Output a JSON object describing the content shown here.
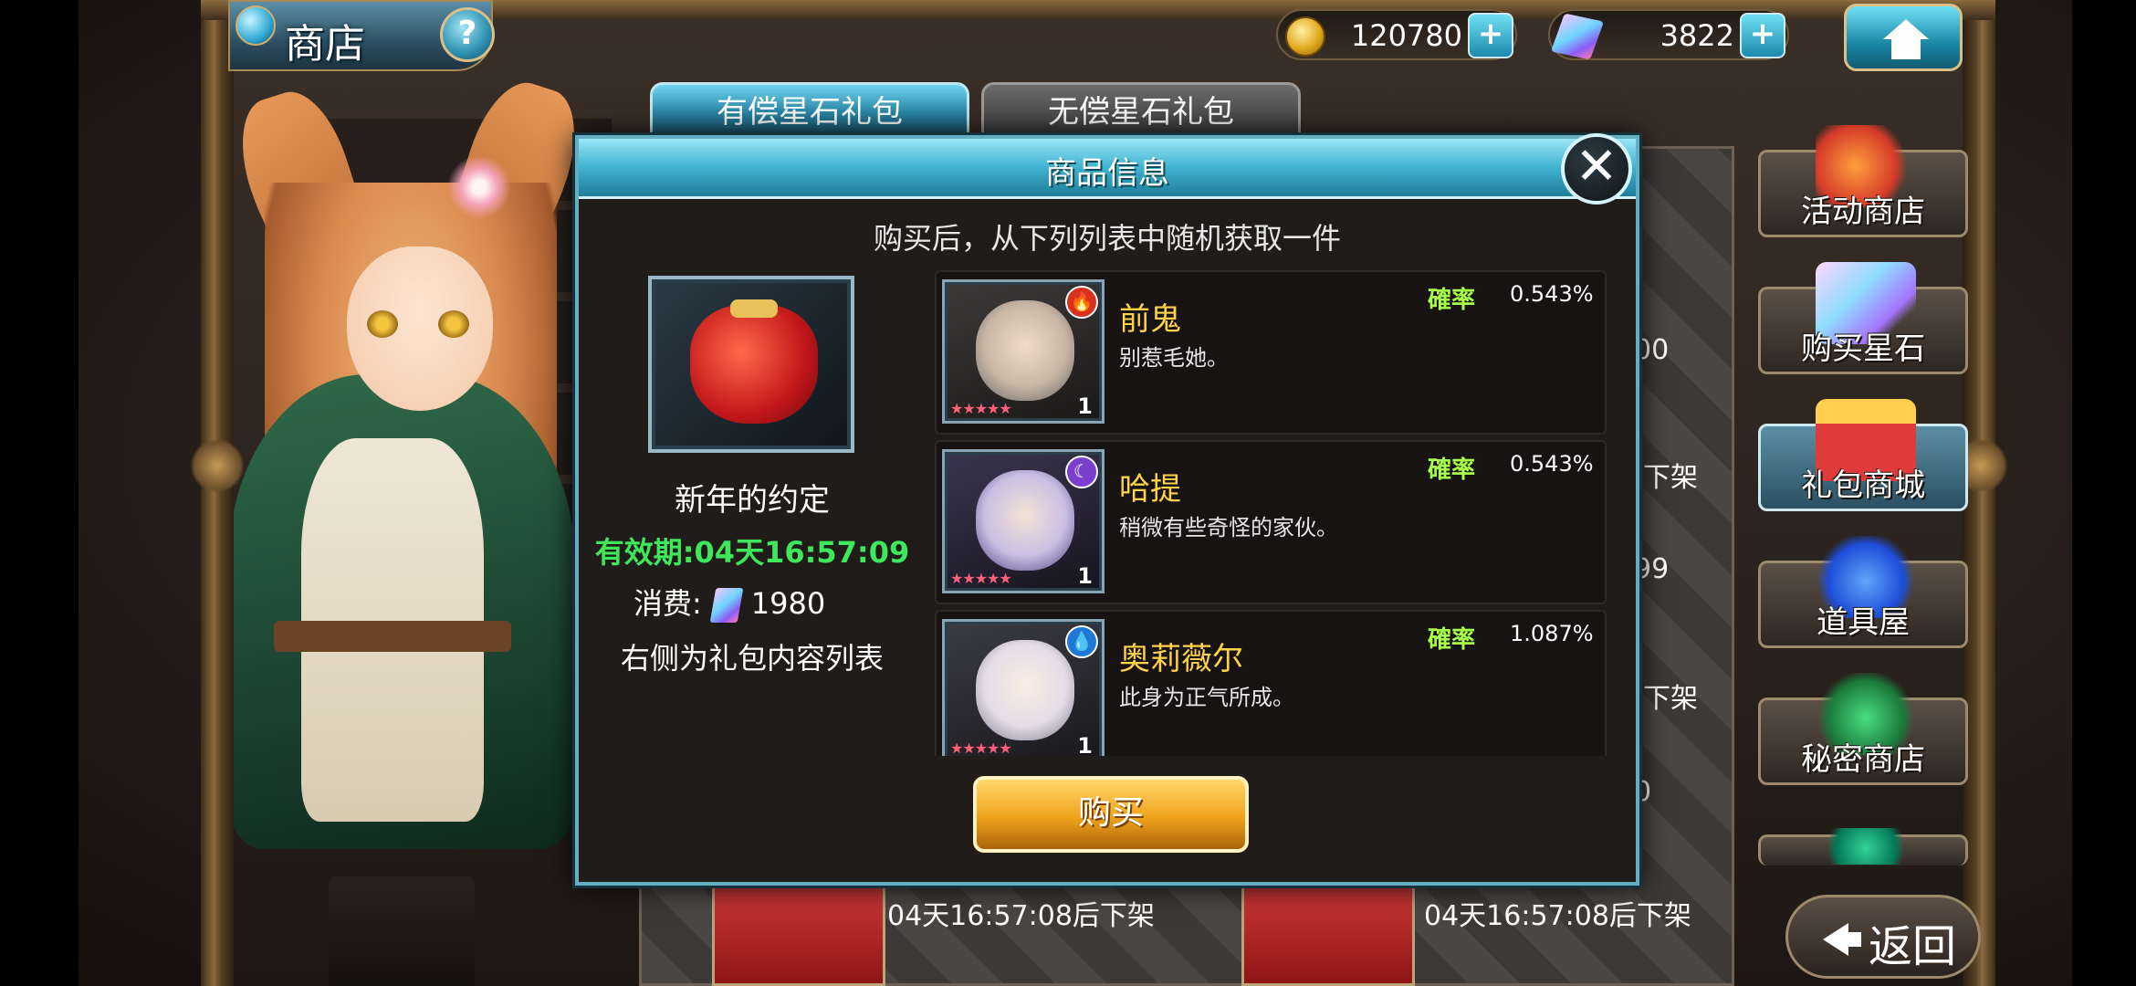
{
  "header": {
    "title": "商店",
    "help_label": "?",
    "coins": "120780",
    "gems": "3822",
    "plus_label": "+"
  },
  "tabs": [
    {
      "label": "有偿星石礼包",
      "active": true
    },
    {
      "label": "无偿星石礼包",
      "active": false
    }
  ],
  "background_list": {
    "prices": [
      "00",
      "99",
      "0"
    ],
    "unlist_short": "下架",
    "unlist_timer_1": "04天16:57:08后下架",
    "unlist_timer_2": "04天16:57:08后下架"
  },
  "side_menu": [
    {
      "label": "活动商店",
      "icon": "event-shop-icon",
      "active": false
    },
    {
      "label": "购买星石",
      "icon": "star-stone-icon",
      "active": false
    },
    {
      "label": "礼包商城",
      "icon": "gift-box-icon",
      "active": true
    },
    {
      "label": "道具屋",
      "icon": "item-shop-icon",
      "active": false
    },
    {
      "label": "秘密商店",
      "icon": "secret-shop-icon",
      "active": false
    },
    {
      "label": "",
      "icon": "crystal-icon",
      "active": false
    }
  ],
  "back_label": "返回",
  "modal": {
    "title": "商品信息",
    "close_label": "✕",
    "subtitle": "购买后，从下列列表中随机获取一件",
    "pack": {
      "name": "新年的约定",
      "valid": "有效期:04天16:57:09",
      "cost_label": "消费:",
      "cost_value": "1980",
      "note": "右侧为礼包内容列表"
    },
    "rate_label": "確率",
    "items": [
      {
        "name": "前鬼",
        "desc": "别惹毛她。",
        "rate": "0.543%",
        "element": "fire",
        "element_glyph": "🔥",
        "level": "1",
        "color": "#d9d2cc"
      },
      {
        "name": "哈提",
        "desc": "稍微有些奇怪的家伙。",
        "rate": "0.543%",
        "element": "dark",
        "element_glyph": "☾",
        "level": "1",
        "color": "#c9c2e4"
      },
      {
        "name": "奥莉薇尔",
        "desc": "此身为正气所成。",
        "rate": "1.087%",
        "element": "water",
        "element_glyph": "💧",
        "level": "1",
        "color": "#e9e6ee"
      }
    ],
    "buy_label": "购买"
  },
  "colors": {
    "accent_blue": "#3fb2d0",
    "gold": "#f0a21c",
    "name_yellow": "#ffd24a",
    "valid_green": "#3fe85a",
    "rate_green": "#a8ff4a"
  }
}
